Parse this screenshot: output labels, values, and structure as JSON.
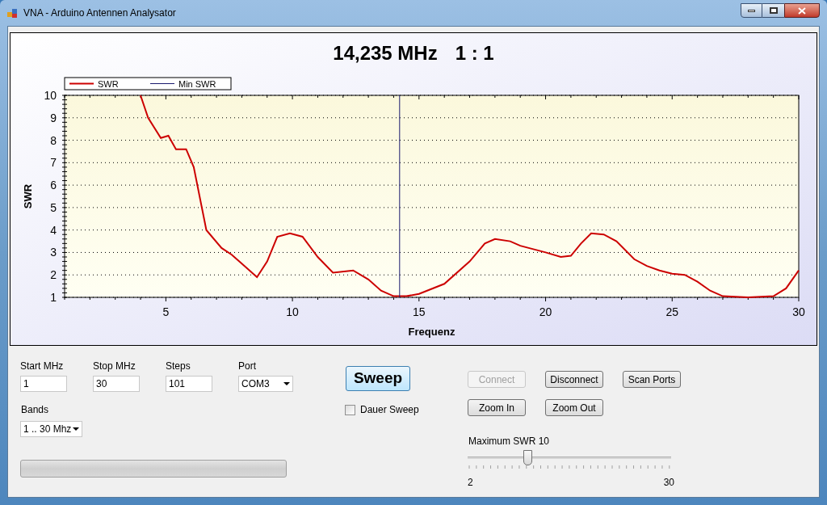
{
  "window": {
    "title": "VNA - Arduino Antennen Analysator"
  },
  "chart": {
    "frequency": "14,235 MHz",
    "ratio": "1 : 1",
    "chart_data": {
      "type": "line",
      "grid": true,
      "legend": true,
      "xlabel": "Frequenz",
      "ylabel": "SWR",
      "xlim": [
        1,
        30
      ],
      "ylim": [
        1,
        10
      ],
      "xticks": [
        5,
        10,
        15,
        20,
        25,
        30
      ],
      "yticks": [
        1,
        2,
        3,
        4,
        5,
        6,
        7,
        8,
        9,
        10
      ],
      "x": [
        4,
        4.3,
        4.8,
        5.1,
        5.4,
        5.8,
        6.1,
        6.6,
        7.2,
        7.6,
        8,
        8.6,
        9,
        9.4,
        9.9,
        10.4,
        11,
        11.6,
        12.4,
        13,
        13.5,
        14,
        14.5,
        15,
        16,
        17,
        17.6,
        18,
        18.6,
        19,
        20,
        20.6,
        21,
        21.4,
        21.8,
        22.3,
        22.8,
        23.5,
        24,
        24.5,
        25,
        25.5,
        26,
        26.5,
        27,
        28,
        29,
        29.5,
        30
      ],
      "series": [
        {
          "name": "SWR",
          "color": "#cc0000",
          "values": [
            10,
            9,
            8.1,
            8.2,
            7.6,
            7.6,
            6.8,
            4,
            3.2,
            2.9,
            2.5,
            1.9,
            2.6,
            3.7,
            3.85,
            3.7,
            2.8,
            2.1,
            2.2,
            1.8,
            1.3,
            1.05,
            1.05,
            1.15,
            1.6,
            2.6,
            3.4,
            3.6,
            3.5,
            3.3,
            3,
            2.8,
            2.85,
            3.4,
            3.85,
            3.8,
            3.5,
            2.7,
            2.4,
            2.2,
            2.05,
            2,
            1.7,
            1.3,
            1.05,
            1,
            1.05,
            1.4,
            2.2
          ]
        },
        {
          "name": "Min SWR",
          "color": "#1a1a6e",
          "x": [
            14.235,
            14.235
          ],
          "values": [
            1,
            10
          ]
        }
      ]
    }
  },
  "fields": [
    {
      "label": "Start MHz",
      "value": "1"
    },
    {
      "label": "Stop MHz",
      "value": "30"
    },
    {
      "label": "Steps",
      "value": "101"
    }
  ],
  "port": {
    "label": "Port",
    "value": "COM3"
  },
  "bands": {
    "label": "Bands",
    "value": "1 .. 30 Mhz"
  },
  "progress": {
    "level": 0
  },
  "sweep_button": "Sweep",
  "continuous_sweep": {
    "label": "Dauer Sweep",
    "checked": false
  },
  "buttons": [
    {
      "label": "Connect",
      "disabled": true
    },
    {
      "label": "Disconnect",
      "disabled": false
    },
    {
      "label": "Scan Ports",
      "disabled": false
    },
    {
      "label": "Zoom In",
      "disabled": false
    },
    {
      "label": "Zoom Out",
      "disabled": false
    }
  ],
  "max_swr": {
    "label": "Maximum SWR",
    "value": "10",
    "level": 0.286,
    "min": "2",
    "max": "30"
  }
}
